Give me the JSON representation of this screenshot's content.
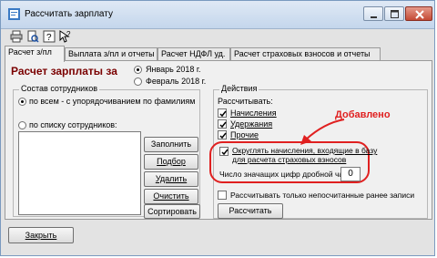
{
  "window": {
    "title": "Рассчитать зарплату",
    "controls": [
      "minimize-icon",
      "maximize-icon",
      "close-icon"
    ]
  },
  "toolbar": {
    "icons": [
      "print-icon",
      "print-preview-icon",
      "help-icon",
      "context-help-icon"
    ]
  },
  "tabs": [
    {
      "label": "Расчет з/пл",
      "active": true
    },
    {
      "label": "Выплата з/пл и отчеты",
      "active": false
    },
    {
      "label": "Расчет НДФЛ уд.",
      "active": false
    },
    {
      "label": "Расчет страховых взносов и отчеты",
      "active": false
    }
  ],
  "heading": "Расчет зарплаты за",
  "period": {
    "options": [
      {
        "label": "Январь 2018 г.",
        "selected": true
      },
      {
        "label": "Февраль 2018 г.",
        "selected": false
      }
    ]
  },
  "staff": {
    "group_label": "Состав сотрудников",
    "options": [
      {
        "label": "по всем - с упорядочиванием по фамилиям",
        "selected": true
      },
      {
        "label": "по списку сотрудников:",
        "selected": false
      }
    ],
    "buttons": [
      "Заполнить",
      "Подбор",
      "Удалить",
      "Очистить",
      "Сортировать"
    ]
  },
  "actions": {
    "group_label": "Действия",
    "calc_label": "Рассчитывать:",
    "checks": [
      {
        "label": "Начисления",
        "checked": true
      },
      {
        "label": "Удержания",
        "checked": true
      },
      {
        "label": "Прочие",
        "checked": true
      }
    ],
    "round": {
      "line1": "Округлять начисления, входящие в базу",
      "line2": "для расчета страховых взносов",
      "checked": true
    },
    "digits_label": "Число значащих цифр дробной части:",
    "digits_value": "0",
    "only_unpaid": {
      "label": "Рассчитывать только непосчитанные ранее записи",
      "checked": false
    },
    "calculate_button": "Рассчитать"
  },
  "annotation": {
    "text": "Добавлено",
    "color": "#e02020"
  },
  "close_button": "Закрыть"
}
